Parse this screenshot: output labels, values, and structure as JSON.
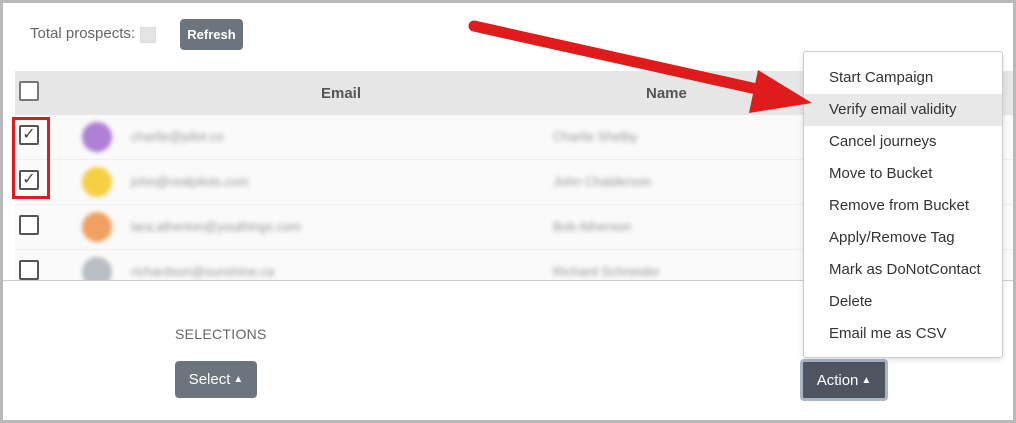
{
  "toolbar": {
    "total_label": "Total prospects:",
    "refresh_label": "Refresh"
  },
  "table": {
    "headers": [
      "Email",
      "Name"
    ],
    "rows": [
      {
        "checked": true,
        "check_glyph": "✓",
        "avatar_color": "#b07fd6",
        "email": "charlie@pilot.co",
        "name": "Charlie Shelby"
      },
      {
        "checked": true,
        "check_glyph": "✓",
        "avatar_color": "#f5d042",
        "email": "john@realpilots.com",
        "name": "John Chalderson"
      },
      {
        "checked": false,
        "check_glyph": "",
        "avatar_color": "#f0a060",
        "email": "lara.atherton@youthings.com",
        "name": "Bob Atherson"
      },
      {
        "checked": false,
        "check_glyph": "",
        "avatar_color": "#b8bec4",
        "email": "richardson@sunshine.ca",
        "name": "Richard Schneider"
      }
    ]
  },
  "bottom": {
    "selections_label": "SELECTIONS",
    "select_label": "Select",
    "action_label": "Action",
    "caret": "▲"
  },
  "action_menu": {
    "items": [
      "Start Campaign",
      "Verify email validity",
      "Cancel journeys",
      "Move to Bucket",
      "Remove from Bucket",
      "Apply/Remove Tag",
      "Mark as DoNotContact",
      "Delete",
      "Email me as CSV"
    ],
    "highlighted": "Verify email validity"
  },
  "colors": {
    "annotation_red": "#e01b1b",
    "button_gray": "#6c757d",
    "action_dark": "#4f5560"
  }
}
